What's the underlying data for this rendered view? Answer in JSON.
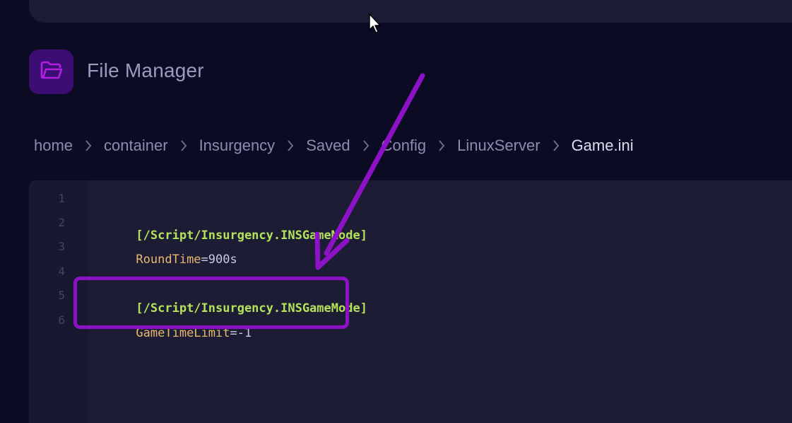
{
  "app": {
    "title": "File Manager",
    "title_icon": "folder-open-icon"
  },
  "breadcrumb": {
    "items": [
      {
        "label": "home"
      },
      {
        "label": "container"
      },
      {
        "label": "Insurgency"
      },
      {
        "label": "Saved"
      },
      {
        "label": "Config"
      },
      {
        "label": "LinuxServer"
      },
      {
        "label": "Game.ini",
        "current": true
      }
    ],
    "separator_icon": "chevron-right-icon"
  },
  "editor": {
    "file_name": "Game.ini",
    "lines": [
      {
        "number": "1",
        "section": "",
        "key": "",
        "op": "",
        "value": ""
      },
      {
        "number": "2",
        "section": "[/Script/Insurgency.INSGameMode]",
        "key": "",
        "op": "",
        "value": ""
      },
      {
        "number": "3",
        "section": "",
        "key": "RoundTime",
        "op": "=",
        "value": "900s"
      },
      {
        "number": "4",
        "section": "",
        "key": "",
        "op": "",
        "value": ""
      },
      {
        "number": "5",
        "section": "[/Script/Insurgency.INSGameMode]",
        "key": "",
        "op": "",
        "value": ""
      },
      {
        "number": "6",
        "section": "",
        "key": "GameTimeLimit",
        "op": "=",
        "value": "-1"
      }
    ]
  },
  "annotation": {
    "highlighted_lines": [
      "5",
      "6"
    ],
    "arrow_icon": "annotation-arrow-icon"
  },
  "colors": {
    "background": "#0b0b24",
    "panel": "#1b1b33",
    "editor_bg": "#1c1c34",
    "accent_purple": "#8d12c7",
    "icon_box": "#3c0d72",
    "section_green": "#b3e35a",
    "key_orange": "#e9b96e",
    "breadcrumb_text": "#8b8db0"
  }
}
